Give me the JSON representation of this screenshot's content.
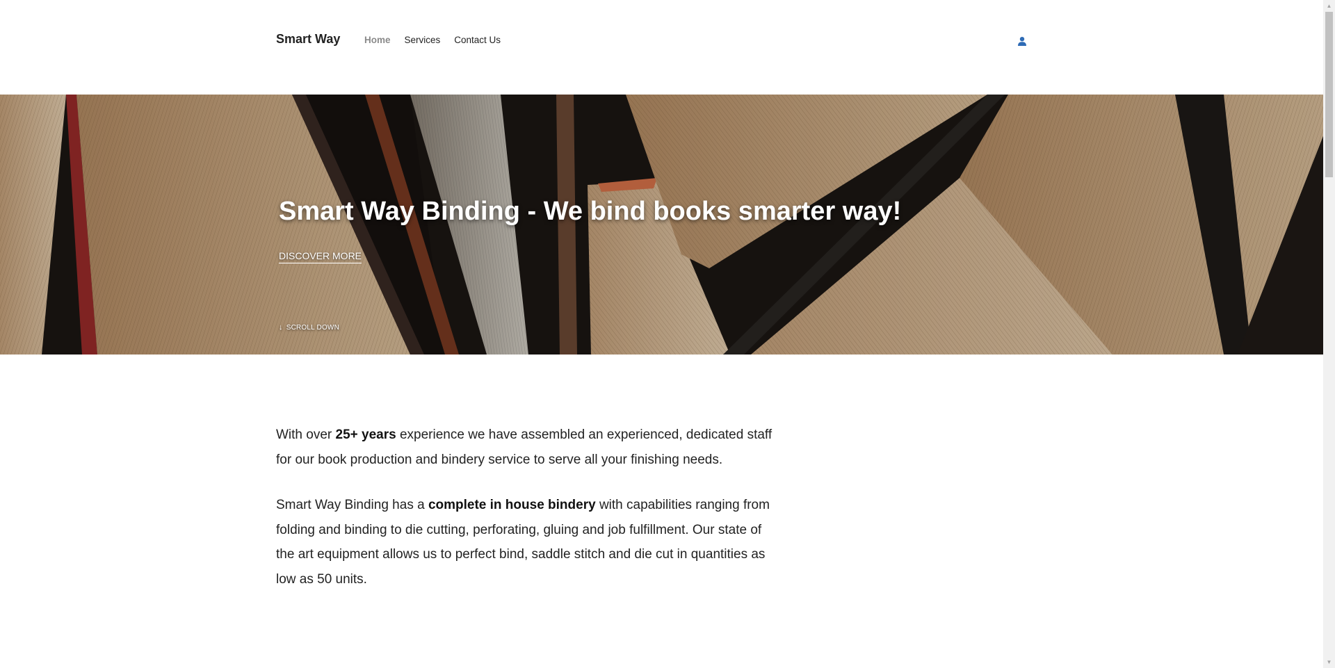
{
  "header": {
    "brand": "Smart Way",
    "nav": [
      {
        "label": "Home",
        "active": true
      },
      {
        "label": "Services",
        "active": false
      },
      {
        "label": "Contact Us",
        "active": false
      }
    ],
    "user_icon": "user-icon",
    "accent": "#2e6bb5"
  },
  "hero": {
    "title": "Smart Way Binding - We bind books smarter way!",
    "cta": "DISCOVER MORE",
    "scroll_label": "SCROLL DOWN",
    "scroll_icon": "arrow-down-icon"
  },
  "content": {
    "p1": {
      "before": "With over ",
      "bold": "25+ years",
      "after": " experience we have assembled an experienced, dedicated staff for our book production and bindery service to serve all your finishing needs."
    },
    "p2": {
      "before": "Smart Way Binding has a ",
      "bold": "complete in house bindery",
      "after": " with capabilities ranging from folding and binding to die cutting, perforating, gluing and job fulfillment. Our state of the art equipment allows us to perfect bind, saddle stitch and die cut in quantities as low as 50 units."
    }
  }
}
